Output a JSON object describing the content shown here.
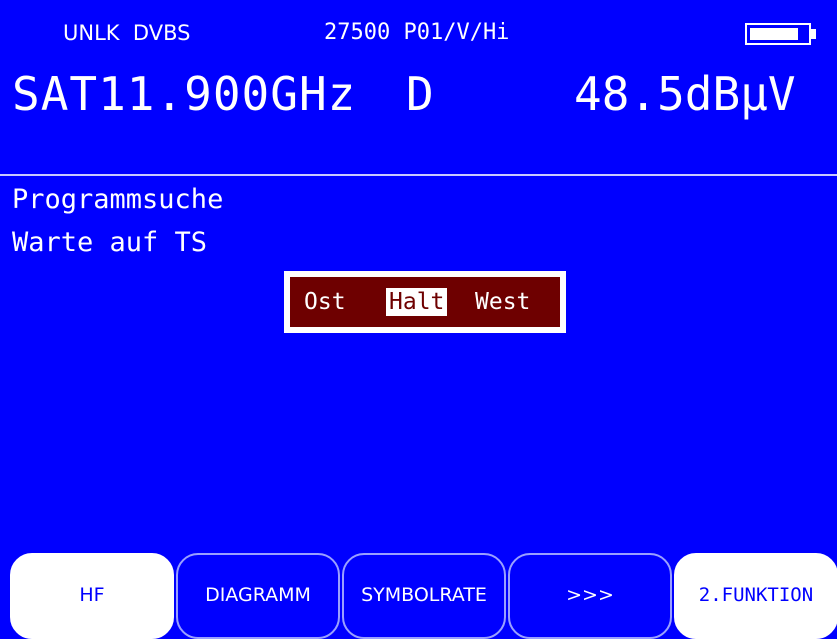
{
  "header": {
    "lock_status": "UNLK  DVBS",
    "transponder": "27500 P01/V/Hi",
    "battery_level": 0.85
  },
  "main_readout": {
    "frequency": "SAT11.900GHz",
    "mode": "D",
    "level": "48.5dBµV"
  },
  "body": {
    "title": "Programmsuche",
    "status": "Warte auf TS"
  },
  "direction_selector": {
    "options": [
      "Ost",
      "Halt",
      "West"
    ],
    "selected": "Halt"
  },
  "softkeys": {
    "hf": "HF",
    "diagramm": "DIAGRAMM",
    "symbolrate": "SYMBOLRATE",
    "more": ">>>",
    "second_function": "2.FUNKTION"
  },
  "colors": {
    "background": "#0000ff",
    "selector_bg": "#6e0000",
    "text": "#ffffff"
  }
}
